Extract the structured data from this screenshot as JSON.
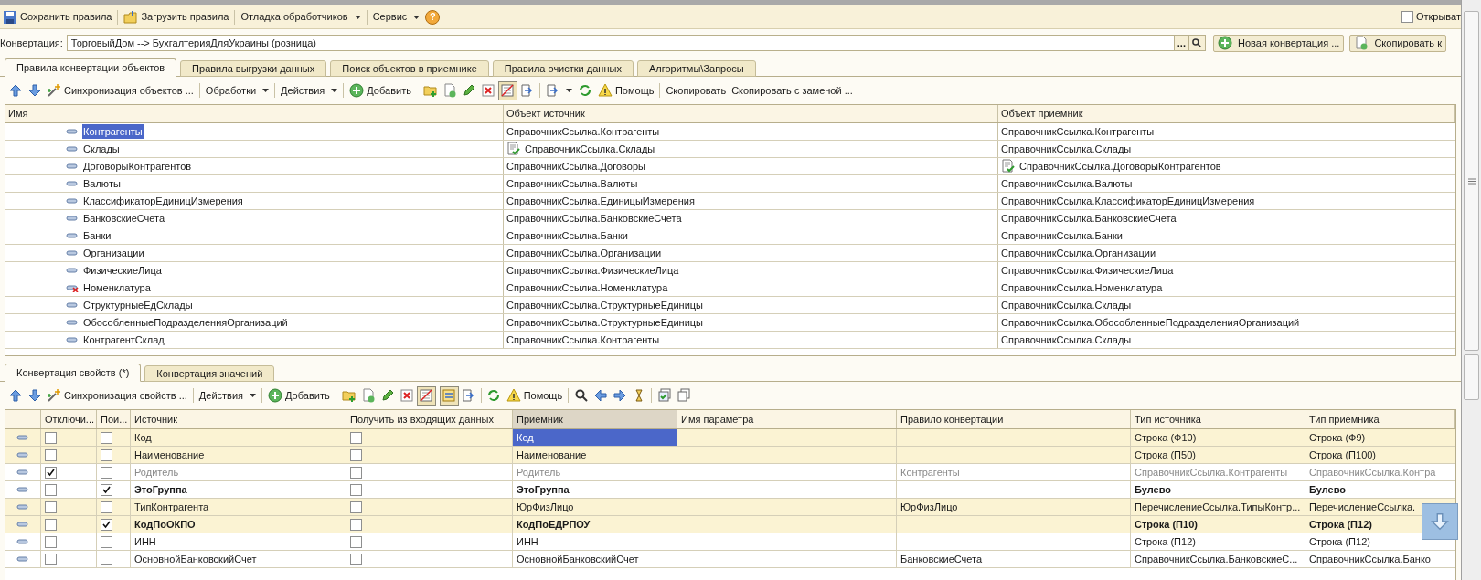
{
  "main_toolbar": [
    {
      "kind": "button",
      "label": "Сохранить правила"
    },
    {
      "kind": "button",
      "label": "Загрузить правила"
    },
    {
      "kind": "menu",
      "label": "Отладка обработчиков"
    },
    {
      "kind": "menu",
      "label": "Сервис"
    },
    {
      "kind": "help",
      "label": "?"
    }
  ],
  "open_option": {
    "label": "Открыват",
    "checked": false
  },
  "conversion": {
    "label": "Конвертация:",
    "value": "ТорговыйДом --> БухгалтерияДляУкраины (розница)",
    "select_button": "...",
    "new_button": "Новая конвертация ...",
    "copy_button": "Скопировать к"
  },
  "tabs": [
    {
      "label": "Правила конвертации объектов",
      "selected": true
    },
    {
      "label": "Правила выгрузки данных",
      "selected": false
    },
    {
      "label": "Поиск объектов в приемнике",
      "selected": false
    },
    {
      "label": "Правила очистки данных",
      "selected": false
    },
    {
      "label": "Алгоритмы\\Запросы",
      "selected": false
    }
  ],
  "object_toolbar": {
    "filter_on": true,
    "items": [
      {
        "kind": "button",
        "label": "Синхронизация объектов ..."
      },
      {
        "kind": "menu",
        "label": "Обработки"
      },
      {
        "kind": "menu",
        "label": "Действия"
      },
      {
        "kind": "button",
        "label": "Добавить"
      },
      {
        "kind": "button",
        "label": "Помощь"
      },
      {
        "kind": "button",
        "label": "Скопировать"
      },
      {
        "kind": "button",
        "label": "Скопировать с заменой ..."
      }
    ]
  },
  "object_table": {
    "columns": [
      "Имя",
      "Объект источник",
      "Объект приемник"
    ],
    "rows": [
      {
        "name": "Контрагенты",
        "source": "СправочникСсылка.Контрагенты",
        "target": "СправочникСсылка.Контрагенты",
        "excluded": false,
        "source_marked": false,
        "target_marked": false,
        "selected": true
      },
      {
        "name": "Склады",
        "source": "СправочникСсылка.Склады",
        "target": "СправочникСсылка.Склады",
        "excluded": false,
        "source_marked": true,
        "target_marked": false,
        "selected": false
      },
      {
        "name": "ДоговорыКонтрагентов",
        "source": "СправочникСсылка.Договоры",
        "target": "СправочникСсылка.ДоговорыКонтрагентов",
        "excluded": false,
        "source_marked": false,
        "target_marked": true,
        "selected": false
      },
      {
        "name": "Валюты",
        "source": "СправочникСсылка.Валюты",
        "target": "СправочникСсылка.Валюты",
        "excluded": false,
        "source_marked": false,
        "target_marked": false,
        "selected": false
      },
      {
        "name": "КлассификаторЕдиницИзмерения",
        "source": "СправочникСсылка.ЕдиницыИзмерения",
        "target": "СправочникСсылка.КлассификаторЕдиницИзмерения",
        "excluded": false,
        "source_marked": false,
        "target_marked": false,
        "selected": false
      },
      {
        "name": "БанковскиеСчета",
        "source": "СправочникСсылка.БанковскиеСчета",
        "target": "СправочникСсылка.БанковскиеСчета",
        "excluded": false,
        "source_marked": false,
        "target_marked": false,
        "selected": false
      },
      {
        "name": "Банки",
        "source": "СправочникСсылка.Банки",
        "target": "СправочникСсылка.Банки",
        "excluded": false,
        "source_marked": false,
        "target_marked": false,
        "selected": false
      },
      {
        "name": "Организации",
        "source": "СправочникСсылка.Организации",
        "target": "СправочникСсылка.Организации",
        "excluded": false,
        "source_marked": false,
        "target_marked": false,
        "selected": false
      },
      {
        "name": "ФизическиеЛица",
        "source": "СправочникСсылка.ФизическиеЛица",
        "target": "СправочникСсылка.ФизическиеЛица",
        "excluded": false,
        "source_marked": false,
        "target_marked": false,
        "selected": false
      },
      {
        "name": "Номенклатура",
        "source": "СправочникСсылка.Номенклатура",
        "target": "СправочникСсылка.Номенклатура",
        "excluded": true,
        "source_marked": false,
        "target_marked": false,
        "selected": false
      },
      {
        "name": "СтруктурныеЕдСклады",
        "source": "СправочникСсылка.СтруктурныеЕдиницы",
        "target": "СправочникСсылка.Склады",
        "excluded": false,
        "source_marked": false,
        "target_marked": false,
        "selected": false
      },
      {
        "name": "ОбособленныеПодразделенияОрганизаций",
        "source": "СправочникСсылка.СтруктурныеЕдиницы",
        "target": "СправочникСсылка.ОбособленныеПодразделенияОрганизаций",
        "excluded": false,
        "source_marked": false,
        "target_marked": false,
        "selected": false
      },
      {
        "name": "КонтрагентСклад",
        "source": "СправочникСсылка.Контрагенты",
        "target": "СправочникСсылка.Склады",
        "excluded": false,
        "source_marked": false,
        "target_marked": false,
        "selected": false
      }
    ]
  },
  "lower_tabs": [
    {
      "label": "Конвертация свойств (*)",
      "selected": true
    },
    {
      "label": "Конвертация значений",
      "selected": false
    }
  ],
  "property_toolbar": {
    "filter_on": true,
    "tree_on": true,
    "items": [
      {
        "kind": "button",
        "label": "Синхронизация свойств ..."
      },
      {
        "kind": "menu",
        "label": "Действия"
      },
      {
        "kind": "button",
        "label": "Добавить"
      },
      {
        "kind": "button",
        "label": "Помощь"
      }
    ]
  },
  "property_table": {
    "columns": [
      {
        "label": "Отключи...",
        "current": false
      },
      {
        "label": "Пои...",
        "current": false
      },
      {
        "label": "Источник",
        "current": false
      },
      {
        "label": "Получить из входящих данных",
        "current": false
      },
      {
        "label": "Приемник",
        "current": true
      },
      {
        "label": "Имя параметра",
        "current": false
      },
      {
        "label": "Правило конвертации",
        "current": false
      },
      {
        "label": "Тип источника",
        "current": false
      },
      {
        "label": "Тип приемника",
        "current": false
      }
    ],
    "rows": [
      {
        "disabled": false,
        "search": false,
        "source": "Код",
        "from_incoming": false,
        "target": "Код",
        "rule": "",
        "source_type": "Строка (Ф10)",
        "target_type": "Строка (Ф9)",
        "highlighted": true,
        "selected": true
      },
      {
        "disabled": false,
        "search": false,
        "source": "Наименование",
        "from_incoming": false,
        "target": "Наименование",
        "rule": "",
        "source_type": "Строка (П50)",
        "target_type": "Строка (П100)",
        "highlighted": true,
        "selected": false
      },
      {
        "disabled": true,
        "search": false,
        "source": "Родитель",
        "from_incoming": false,
        "target": "Родитель",
        "rule": "Контрагенты",
        "source_type": "СправочникСсылка.Контрагенты",
        "target_type": "СправочникСсылка.Контра",
        "highlighted": false,
        "selected": false
      },
      {
        "disabled": false,
        "search": true,
        "source": "ЭтоГруппа",
        "from_incoming": false,
        "target": "ЭтоГруппа",
        "rule": "",
        "source_type": "Булево",
        "target_type": "Булево",
        "highlighted": false,
        "selected": false
      },
      {
        "disabled": false,
        "search": false,
        "source": "ТипКонтрагента",
        "from_incoming": false,
        "target": "ЮрФизЛицо",
        "rule": "ЮрФизЛицо",
        "source_type": "ПеречислениеСсылка.ТипыКонтр...",
        "target_type": "ПеречислениеСсылка.",
        "highlighted": true,
        "selected": false
      },
      {
        "disabled": false,
        "search": true,
        "source": "КодПоОКПО",
        "from_incoming": false,
        "target": "КодПоЕДРПОУ",
        "rule": "",
        "source_type": "Строка (П10)",
        "target_type": "Строка (П12)",
        "highlighted": true,
        "selected": false
      },
      {
        "disabled": false,
        "search": false,
        "source": "ИНН",
        "from_incoming": false,
        "target": "ИНН",
        "rule": "",
        "source_type": "Строка (П12)",
        "target_type": "Строка (П12)",
        "highlighted": false,
        "selected": false
      },
      {
        "disabled": false,
        "search": false,
        "source": "ОсновнойБанковскийСчет",
        "from_incoming": false,
        "target": "ОсновнойБанковскийСчет",
        "rule": "БанковскиеСчета",
        "source_type": "СправочникСсылка.БанковскиеС...",
        "target_type": "СправочникСсылка.Банко",
        "highlighted": false,
        "selected": false
      }
    ]
  }
}
